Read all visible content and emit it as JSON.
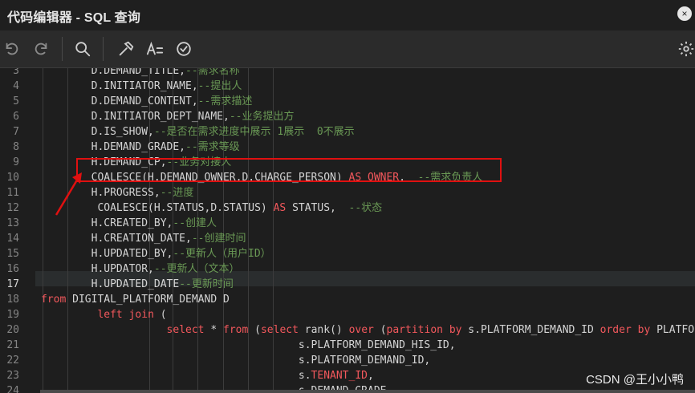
{
  "window": {
    "title": "代码编辑器 - SQL 查询",
    "close_glyph": "×"
  },
  "toolbar": {
    "icons": [
      "undo-icon",
      "redo-icon",
      "search-icon",
      "hammer-icon",
      "format-icon",
      "check-circle-icon",
      "settings-icon"
    ]
  },
  "editor": {
    "active_line": "17",
    "lines": [
      {
        "n": "3",
        "code": "        D.DEMAND_TITLE,--需求名称"
      },
      {
        "n": "4",
        "code": "        D.INITIATOR_NAME,--提出人"
      },
      {
        "n": "5",
        "code": "        D.DEMAND_CONTENT,--需求描述"
      },
      {
        "n": "6",
        "code": "        D.INITIATOR_DEPT_NAME,--业务提出方"
      },
      {
        "n": "7",
        "code": "        D.IS_SHOW,--是否在需求进度中展示 1展示  0不展示"
      },
      {
        "n": "8",
        "code": "        H.DEMAND_GRADE,--需求等级"
      },
      {
        "n": "9",
        "code": "        H.DEMAND_CP,--业务对接人"
      },
      {
        "n": "10",
        "code": "        COALESCE(H.DEMAND_OWNER,D.CHARGE_PERSON) AS OWNER,  --需求负责人"
      },
      {
        "n": "11",
        "code": "        H.PROGRESS,--进度"
      },
      {
        "n": "12",
        "code": "         COALESCE(H.STATUS,D.STATUS) AS STATUS,  --状态"
      },
      {
        "n": "13",
        "code": "        H.CREATED_BY,--创建人"
      },
      {
        "n": "14",
        "code": "        H.CREATION_DATE,--创建时间"
      },
      {
        "n": "15",
        "code": "        H.UPDATED_BY,--更新人（用户ID）"
      },
      {
        "n": "16",
        "code": "        H.UPDATOR,--更新人（文本）"
      },
      {
        "n": "17",
        "code": "        H.UPDATED_DATE--更新时间"
      },
      {
        "n": "18",
        "code": "from DIGITAL_PLATFORM_DEMAND D"
      },
      {
        "n": "19",
        "code": "         left join ("
      },
      {
        "n": "20",
        "code": "                    select * from (select rank() over (partition by s.PLATFORM_DEMAND_ID order by PLATFORM_"
      },
      {
        "n": "21",
        "code": "                                         s.PLATFORM_DEMAND_HIS_ID,"
      },
      {
        "n": "22",
        "code": "                                         s.PLATFORM_DEMAND_ID,"
      },
      {
        "n": "23",
        "code": "                                         s.TENANT_ID,"
      },
      {
        "n": "24",
        "code": "                                         s.DEMAND_GRADE,"
      }
    ]
  },
  "watermark": "CSDN @王小小鸭"
}
